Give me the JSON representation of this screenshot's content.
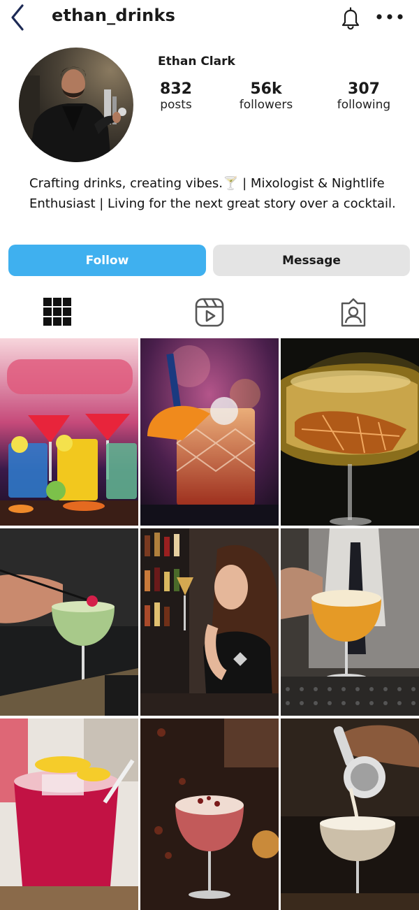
{
  "header": {
    "username": "ethan_drinks",
    "back_icon": "chevron-left-icon",
    "notifications_icon": "bell-icon",
    "more_icon": "more-horizontal-icon"
  },
  "profile": {
    "full_name": "Ethan Clark",
    "avatar": "profile-photo-bartender",
    "stats": [
      {
        "value": "832",
        "label": "posts"
      },
      {
        "value": "56k",
        "label": "followers"
      },
      {
        "value": "307",
        "label": "following"
      }
    ],
    "bio": "Crafting drinks, creating vibes.🍸 | Mixologist & Nightlife Enthusiast | Living for the next great story over a cocktail."
  },
  "actions": {
    "follow_label": "Follow",
    "message_label": "Message"
  },
  "tabs": [
    {
      "name": "posts-grid",
      "icon": "grid-icon",
      "active": true
    },
    {
      "name": "reels",
      "icon": "reels-icon",
      "active": false
    },
    {
      "name": "tagged",
      "icon": "tagged-user-icon",
      "active": false
    }
  ],
  "posts": [
    {
      "subject": "colorful-cocktails-on-bar"
    },
    {
      "subject": "negroni-with-orange-slice"
    },
    {
      "subject": "martini-with-dried-orange"
    },
    {
      "subject": "green-cocktail-garnish"
    },
    {
      "subject": "woman-sipping-wine"
    },
    {
      "subject": "foamy-cocktail-on-bar"
    },
    {
      "subject": "red-iced-drink-lemon"
    },
    {
      "subject": "sour-cocktail-rose-petals"
    },
    {
      "subject": "bartender-straining-drink"
    }
  ],
  "colors": {
    "accent": "#3fb0ef",
    "secondary_button": "#e4e4e4",
    "text": "#111111"
  }
}
